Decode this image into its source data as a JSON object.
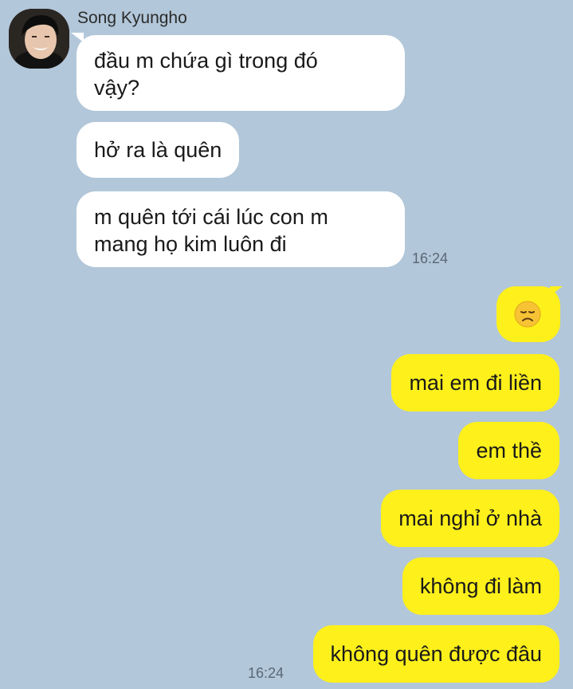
{
  "incoming": {
    "sender_name": "Song Kyungho",
    "messages": [
      {
        "text": "đầu m chứa gì trong đó\nvậy?"
      },
      {
        "text": "hở ra là quên"
      },
      {
        "text": "m quên tới cái lúc con m\nmang họ kim luôn đi"
      }
    ],
    "timestamp": "16:24"
  },
  "outgoing": {
    "emoticon": {
      "name": "disappointed-face-icon"
    },
    "messages": [
      {
        "text": "mai em đi liền"
      },
      {
        "text": "em thề"
      },
      {
        "text": "mai nghỉ ở nhà"
      },
      {
        "text": "không đi làm"
      },
      {
        "text": "không quên được đâu"
      }
    ],
    "timestamp": "16:24"
  },
  "colors": {
    "background": "#b2c7d9",
    "incoming_bubble": "#ffffff",
    "outgoing_bubble": "#fef01b"
  }
}
